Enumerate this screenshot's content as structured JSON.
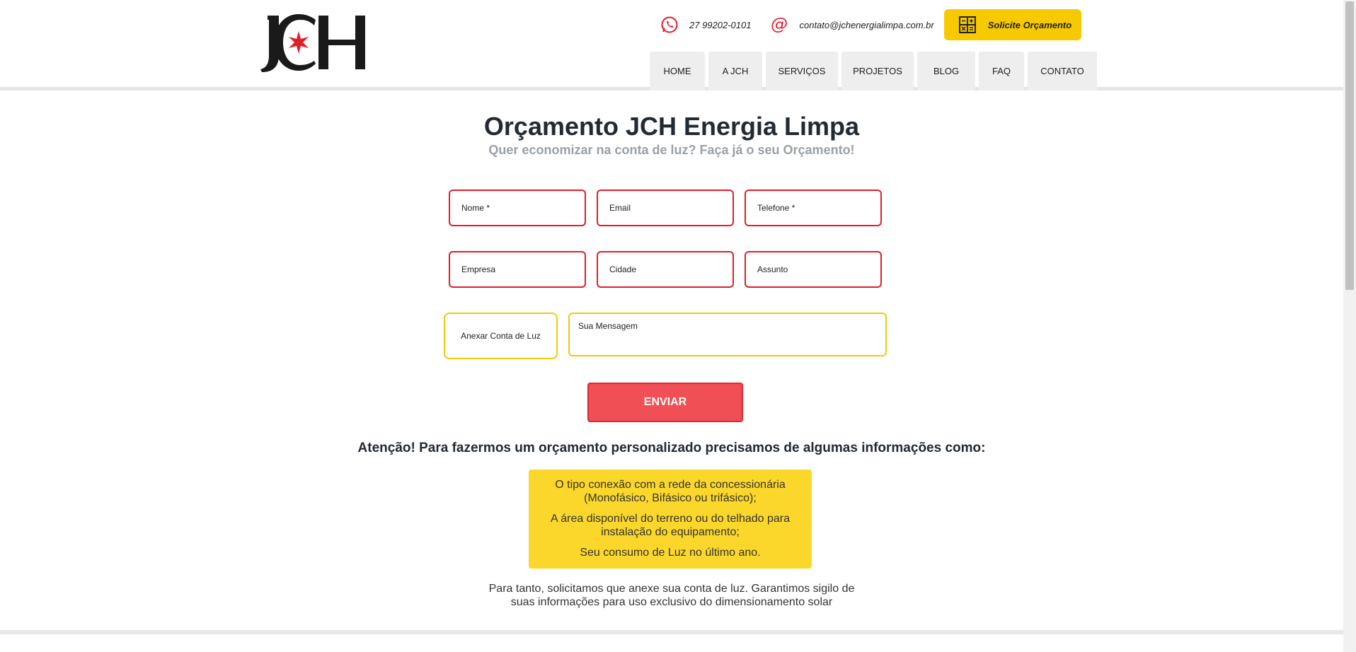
{
  "brand": {
    "logo_text": "JCH",
    "logo_accent_color": "#e11d2a"
  },
  "header": {
    "phone": "27 99202-0101",
    "phone_icon": "whatsapp-icon",
    "email": "contato@jchenergialimpa.com.br",
    "email_icon": "at-icon",
    "cta_label": "Solicite Orçamento",
    "cta_icon": "calculator-icon",
    "cta_color": "#f7c900"
  },
  "nav": {
    "items": [
      {
        "label": "HOME"
      },
      {
        "label": "A JCH"
      },
      {
        "label": "SERVIÇOS"
      },
      {
        "label": "PROJETOS"
      },
      {
        "label": "BLOG"
      },
      {
        "label": "FAQ"
      },
      {
        "label": "CONTATO"
      }
    ]
  },
  "main": {
    "title": "Orçamento JCH Energia Limpa",
    "subtitle": "Quer economizar na conta de luz? Faça já o seu Orçamento!"
  },
  "form": {
    "nome_placeholder": "Nome *",
    "email_placeholder": "Email",
    "telefone_placeholder": "Telefone *",
    "empresa_placeholder": "Empresa",
    "cidade_placeholder": "Cidade",
    "assunto_placeholder": "Assunto",
    "attach_label": "Anexar Conta de Luz",
    "message_placeholder": "Sua Mensagem",
    "submit_label": "ENVIAR",
    "field_border_color": "#e11d2a",
    "secondary_border_color": "#f2c811",
    "submit_color": "#ef4f55"
  },
  "notice": {
    "heading": "Atenção! Para fazermos um orçamento personalizado precisamos de algumas informações como:",
    "items": [
      "O tipo conexão com a rede da concessionária (Monofásico, Bifásico ou trifásico);",
      "A área disponível do terreno ou do telhado para instalação do equipamento;",
      "Seu consumo de Luz no último ano."
    ],
    "box_color": "#fbd72b",
    "footer": "Para tanto, solicitamos que anexe sua conta de luz. Garantimos sigilo de suas informações para uso exclusivo do dimensionamento solar"
  }
}
